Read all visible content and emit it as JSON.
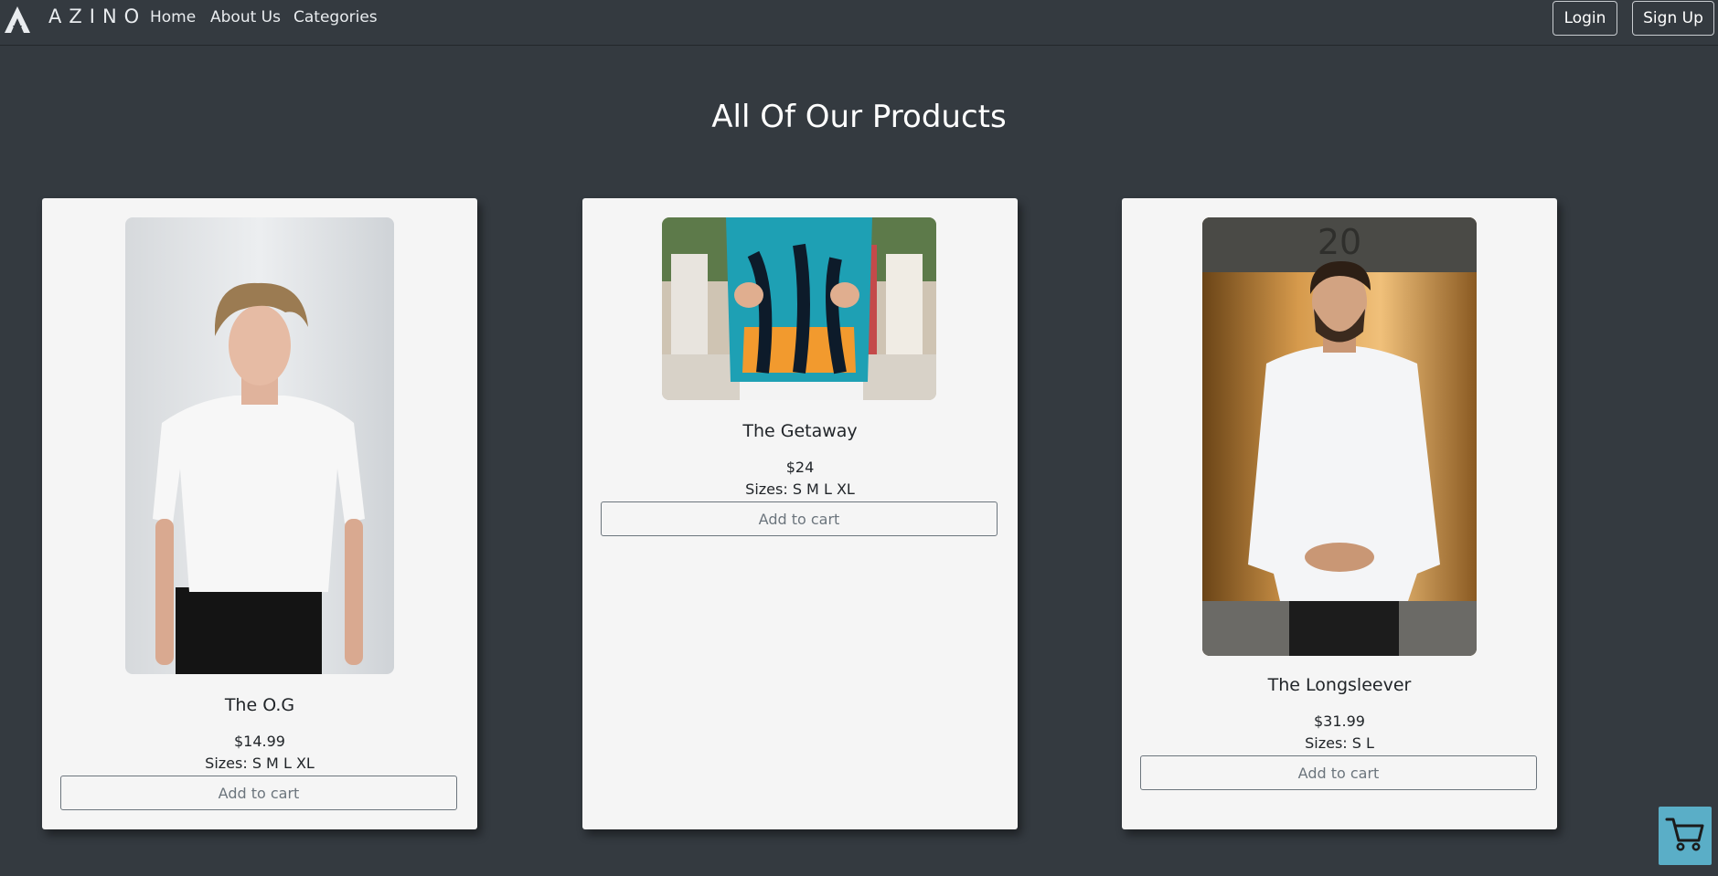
{
  "nav": {
    "brand": "AZINO",
    "links": [
      "Home",
      "About Us",
      "Categories"
    ],
    "login_label": "Login",
    "signup_label": "Sign Up",
    "logo_icon": "a-triangle-logo-icon"
  },
  "heading": "All Of Our Products",
  "products": [
    {
      "name": "The O.G",
      "price": "$14.99",
      "sizes": "Sizes: S M L XL",
      "button": "Add to cart"
    },
    {
      "name": "The Getaway",
      "price": "$24",
      "sizes": "Sizes: S M L XL",
      "button": "Add to cart"
    },
    {
      "name": "The Longsleever",
      "price": "$31.99",
      "sizes": "Sizes: S L",
      "button": "Add to cart"
    }
  ],
  "floating_cart": {
    "icon": "shopping-cart-icon",
    "color": "#5aaec7"
  },
  "colors": {
    "background": "#343a40",
    "card": "#f5f5f5"
  }
}
